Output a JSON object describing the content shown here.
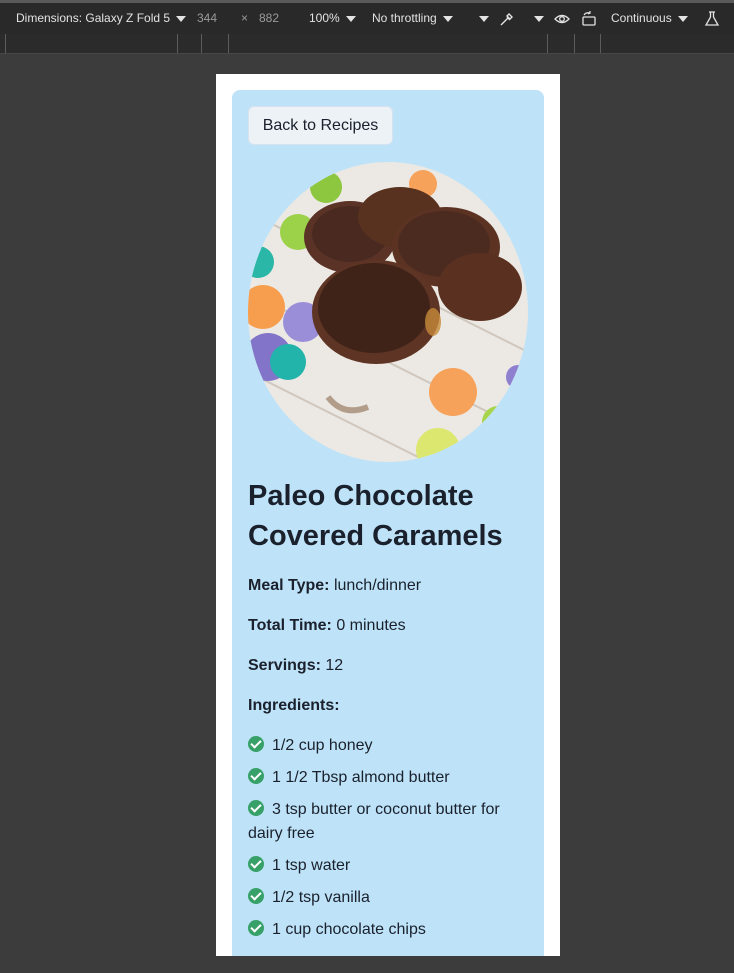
{
  "devtools": {
    "dimensions_label": "Dimensions: Galaxy Z Fold 5",
    "width": "344",
    "times": "×",
    "height": "882",
    "zoom": "100%",
    "throttling": "No throttling",
    "update_mode": "Continuous",
    "icons": [
      "chevron-down-icon",
      "eyedropper-icon",
      "eye-icon",
      "rotate-device-icon",
      "flask-icon"
    ]
  },
  "page": {
    "back_label": "Back to Recipes",
    "image_alt": "chocolate covered caramels",
    "title": "Paleo Chocolate Covered Caramels",
    "meal_type_label": "Meal Type:",
    "meal_type_value": "lunch/dinner",
    "total_time_label": "Total Time:",
    "total_time_value": "0 minutes",
    "servings_label": "Servings:",
    "servings_value": "12",
    "ingredients_label": "Ingredients:",
    "ingredients": [
      "1/2 cup honey",
      "1 1/2 Tbsp almond butter",
      "3 tsp butter or coconut butter for dairy free",
      "1 tsp water",
      "1/2 tsp vanilla",
      "1 cup chocolate chips"
    ],
    "colors": {
      "card_bg": "#bee3f8",
      "check": "#38a169",
      "text": "#1a202c"
    }
  }
}
